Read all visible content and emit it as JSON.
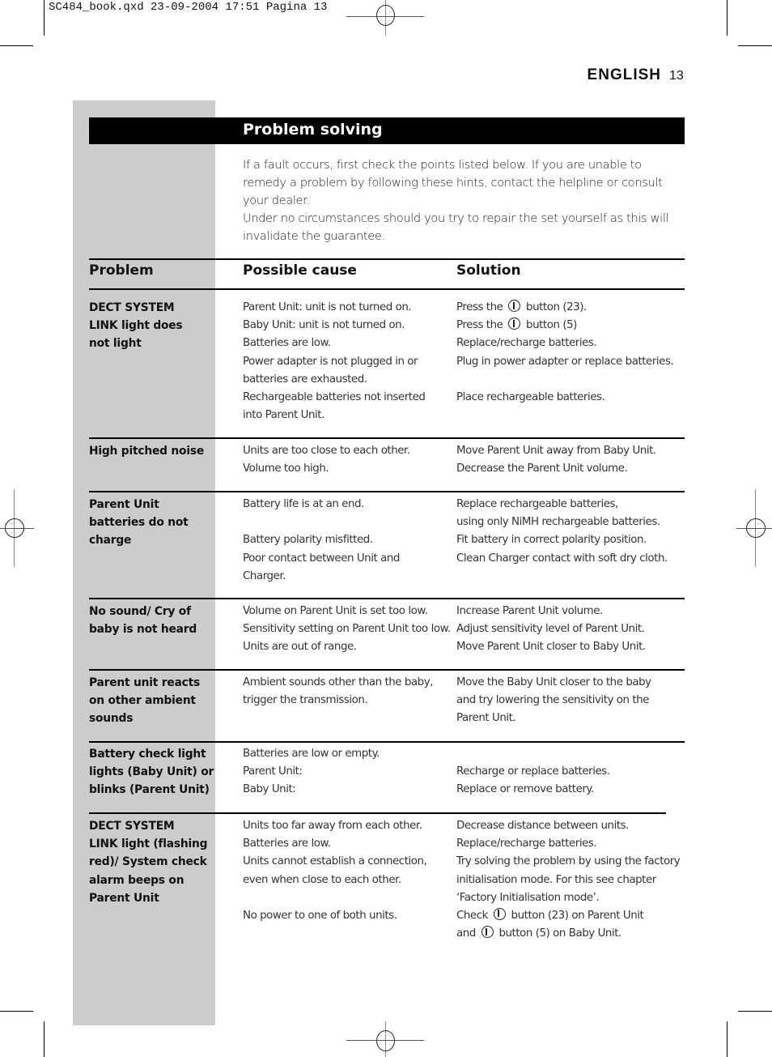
{
  "slug": "SC484_book.qxd 23-09-2004 17:51 Pagina 13",
  "header": {
    "language": "ENGLISH",
    "page_number": "13"
  },
  "section": {
    "title": "Problem solving",
    "intro": [
      "If a fault occurs, first check the points listed below. If you are unable to remedy a problem by following these hints, contact the helpline or consult your dealer.",
      "Under no circumstances should you try to repair the set yourself as this will invalidate the guarantee."
    ]
  },
  "table": {
    "headers": {
      "problem": "Problem",
      "cause": "Possible cause",
      "solution": "Solution"
    },
    "rows": [
      {
        "problem": [
          "DECT SYSTEM",
          "LINK light does",
          "not light"
        ],
        "cause": [
          "Parent Unit: unit is not turned on.",
          "Baby Unit: unit is not turned on.",
          "Batteries are low.",
          "Power adapter is not plugged in or",
          "batteries are exhausted.",
          "Rechargeable batteries not inserted",
          "into Parent Unit."
        ],
        "solution": [
          "Press the [power] button (23).",
          "Press the [power] button (5)",
          "Replace/recharge batteries.",
          "Plug in power adapter or replace batteries.",
          "",
          "Place rechargeable batteries.",
          ""
        ]
      },
      {
        "problem": [
          "High pitched noise"
        ],
        "cause": [
          "Units are too close to each other.",
          "Volume too high."
        ],
        "solution": [
          "Move Parent Unit away from Baby Unit.",
          "Decrease the Parent Unit volume."
        ]
      },
      {
        "problem": [
          "Parent Unit",
          "batteries do not",
          "charge"
        ],
        "cause": [
          "Battery life is at an end.",
          "",
          "Battery polarity misfitted.",
          "Poor contact between Unit and",
          "Charger."
        ],
        "solution": [
          "Replace rechargeable batteries,",
          "using only NiMH rechargeable batteries.",
          "Fit battery in correct polarity position.",
          "Clean Charger contact with soft dry cloth.",
          ""
        ]
      },
      {
        "problem": [
          "No sound/ Cry of",
          "baby is not heard"
        ],
        "cause": [
          "Volume on Parent Unit is set too low.",
          "Sensitivity setting on Parent Unit too low.",
          "Units are out of range."
        ],
        "solution": [
          "Increase Parent Unit volume.",
          "Adjust sensitivity level of Parent Unit.",
          "Move Parent Unit closer to Baby Unit."
        ]
      },
      {
        "problem": [
          "Parent unit reacts",
          "on other ambient",
          "sounds"
        ],
        "cause": [
          "Ambient sounds other than the baby,",
          "trigger the transmission.",
          ""
        ],
        "solution": [
          "Move the Baby Unit closer to the baby",
          "and try lowering the sensitivity on the",
          "Parent Unit."
        ]
      },
      {
        "problem": [
          "Battery check light",
          "lights (Baby Unit) or",
          "blinks (Parent Unit)"
        ],
        "cause": [
          "Batteries are low or empty.",
          "Parent Unit:",
          "Baby Unit:"
        ],
        "solution": [
          "",
          "Recharge or replace batteries.",
          "Replace or remove battery."
        ]
      },
      {
        "problem": [
          "DECT SYSTEM",
          "LINK light (flashing",
          "red)/ System check",
          "alarm beeps on",
          "Parent Unit"
        ],
        "cause": [
          "Units too far away from each other.",
          "Batteries are low.",
          "Units cannot establish a connection,",
          "even when close to each other.",
          "",
          "No power to one of both units.",
          ""
        ],
        "solution": [
          "Decrease distance between units.",
          "Replace/recharge batteries.",
          "Try solving the problem by using the factory",
          "initialisation mode. For this see chapter",
          "‘Factory Initialisation mode’.",
          "Check [power] button (23) on Parent Unit",
          "and [power] button (5) on Baby Unit."
        ]
      }
    ]
  },
  "icons": {
    "power": "power-button-icon"
  }
}
